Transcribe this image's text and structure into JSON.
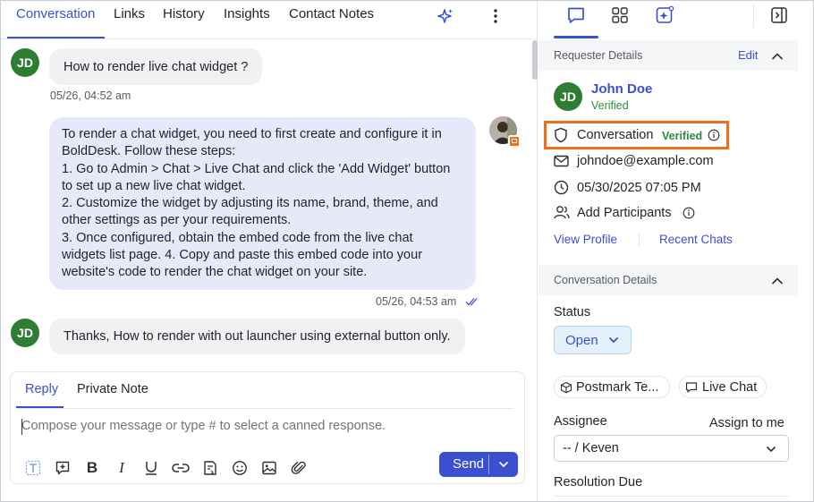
{
  "tabs": {
    "items": [
      "Conversation",
      "Links",
      "History",
      "Insights",
      "Contact Notes"
    ],
    "active": "Conversation"
  },
  "messages": {
    "m1": {
      "initials": "JD",
      "text": "How to render live chat widget ?",
      "time": "05/26, 04:52 am"
    },
    "m2": {
      "text": "To render a chat widget, you need to first create and configure it in\nBoldDesk. Follow these steps:\n1. Go to Admin > Chat > Live Chat and click the 'Add Widget' button\nto set up a new live chat widget.\n2. Customize the widget by adjusting its name, brand, theme, and\nother settings as per your requirements.\n3. Once configured, obtain the embed code from the live chat\nwidgets list page. 4. Copy and paste this embed code into your\nwebsite's code to render the chat widget on your site.",
      "time": "05/26, 04:53 am"
    },
    "m3": {
      "initials": "JD",
      "text": "Thanks, How to render with out launcher using external button only."
    }
  },
  "reply": {
    "tabs": [
      "Reply",
      "Private Note"
    ],
    "placeholder": "Compose your message or type # to select a canned response.",
    "send_label": "Send",
    "toolbar_icons": [
      "text-format-icon",
      "comment-plus-icon",
      "bold-icon",
      "italic-icon",
      "underline-icon",
      "link-icon",
      "canned-response-icon",
      "emoji-icon",
      "image-icon",
      "attachment-icon"
    ]
  },
  "requester": {
    "section_title": "Requester Details",
    "edit_label": "Edit",
    "initials": "JD",
    "name": "John Doe",
    "name_status": "Verified",
    "channel": "Conversation",
    "channel_status": "Verified",
    "email": "johndoe@example.com",
    "datetime": "05/30/2025 07:05 PM",
    "add_participants": "Add Participants",
    "view_profile": "View Profile",
    "recent_chats": "Recent Chats"
  },
  "conversation_details": {
    "section_title": "Conversation Details",
    "status_label": "Status",
    "status_value": "Open",
    "chips": [
      "Postmark Te...",
      "Live Chat"
    ],
    "assignee_label": "Assignee",
    "assign_to_me": "Assign to me",
    "assignee_value": "-- / Keven",
    "resolution_due_label": "Resolution Due"
  },
  "colors": {
    "accent": "#3b4fd1",
    "avatar_green": "#2e7d32",
    "verified_green": "#2e8b3e",
    "highlight_orange": "#f36d1c",
    "agent_bubble": "#e8e8fb"
  }
}
